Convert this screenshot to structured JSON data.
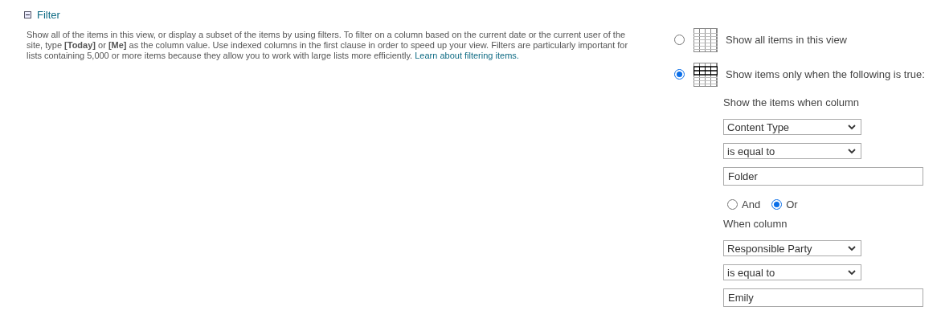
{
  "section": {
    "title": "Filter",
    "expanded": true,
    "description": "Show all of the items in this view, or display a subset of the items by using filters. To filter on a column based on the current date or the current user of the site, type **[Today]** or **[Me]** as the column value. Use indexed columns in the first clause in order to speed up your view. Filters are particularly important for lists containing 5,000 or more items because they allow you to work with large lists more efficiently.",
    "link": "Learn about filtering items."
  },
  "options": [
    {
      "kind": "all",
      "label": "Show all items in this view",
      "selected": false
    },
    {
      "kind": "filtered",
      "label": "Show items only when the following is true:",
      "selected": true
    }
  ],
  "first_clause": {
    "column_label": "Show the items when column",
    "column": "Content Type",
    "operator": "is equal to",
    "value": "Folder"
  },
  "join": [
    {
      "label": "And",
      "selected": false
    },
    {
      "label": "Or",
      "selected": true
    }
  ],
  "second_clause": {
    "column_label": "When column",
    "column": "Responsible Party",
    "operator": "is equal to",
    "value": "Emily"
  }
}
